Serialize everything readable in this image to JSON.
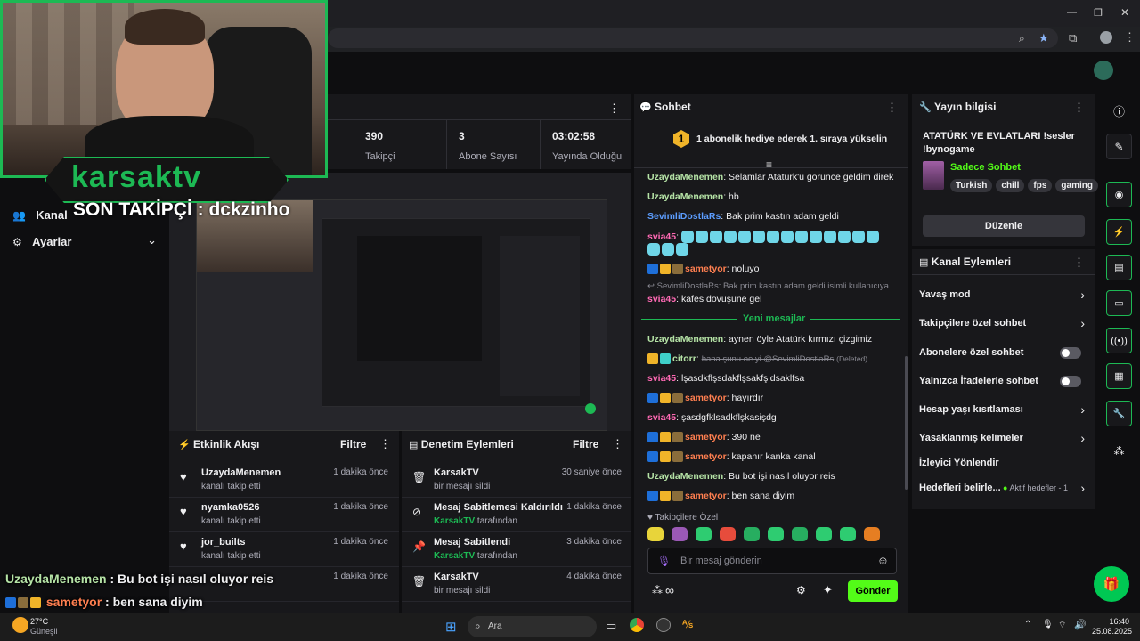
{
  "browser": {
    "controls": [
      "—",
      "❐",
      "✕"
    ]
  },
  "left_nav": {
    "items": [
      {
        "label": "Kanal"
      },
      {
        "label": "Ayarlar"
      }
    ]
  },
  "webcam": {
    "channel": "karsaktv",
    "last_follower": "SON TAKİPÇİ : dckzinho"
  },
  "stats": [
    {
      "value": "390",
      "label": "Takipçi"
    },
    {
      "value": "3",
      "label": "Abone Sayısı"
    },
    {
      "value": "03:02:58",
      "label": "Yayında Olduğu"
    }
  ],
  "activity_feed": {
    "title": "Etkinlik Akışı",
    "filter": "Filtre",
    "rows": [
      {
        "user": "UzaydaMenemen",
        "action": "kanalı takip etti",
        "time": "1 dakika önce"
      },
      {
        "user": "nyamka0526",
        "action": "kanalı takip etti",
        "time": "1 dakika önce"
      },
      {
        "user": "jor_builts",
        "action": "kanalı takip etti",
        "time": "1 dakika önce"
      },
      {
        "user": "",
        "action": "",
        "time": "1 dakika önce"
      }
    ]
  },
  "mod_actions": {
    "title": "Denetim Eylemleri",
    "filter": "Filtre",
    "rows": [
      {
        "title": "KarsakTV",
        "sub_user": "",
        "sub": "bir mesajı sildi",
        "time": "30 saniye önce"
      },
      {
        "title": "Mesaj Sabitlemesi Kaldırıldı",
        "sub_user": "KarsakTV",
        "sub": "tarafından",
        "time": "1 dakika önce"
      },
      {
        "title": "Mesaj Sabitlendi",
        "sub_user": "KarsakTV",
        "sub": "tarafından",
        "time": "3 dakika önce"
      },
      {
        "title": "KarsakTV",
        "sub_user": "",
        "sub": "bir mesajı sildi",
        "time": "4 dakika önce"
      }
    ]
  },
  "chat": {
    "title": "Sohbet",
    "pinned": "1 abonelik hediye ederek 1. sıraya yükselin",
    "pinned_badge": "1",
    "messages": [
      {
        "user": "UzaydaMenemen",
        "text": "Selamlar Atatürk'ü görünce geldim direk",
        "color": "green"
      },
      {
        "user": "UzaydaMenemen",
        "text": "hb",
        "color": "green"
      },
      {
        "user": "SevimliDostlaRs",
        "text": "Bak prim kastın adam geldi",
        "color": "blue"
      },
      {
        "user": "svia45",
        "text": "",
        "color": "pink"
      },
      {
        "user": "sametyor",
        "text": "noluyo",
        "color": "orange"
      },
      {
        "user": "",
        "text": "SevimliDostlaRs: Bak prim kastın adam geldi isimli kullanıcıya...",
        "color": "muted"
      },
      {
        "user": "svia45",
        "text": "kafes dövüşüne gel",
        "color": "pink"
      }
    ],
    "new_messages": "Yeni mesajlar",
    "messages2": [
      {
        "user": "UzaydaMenemen",
        "text": "aynen öyle Atatürk kırmızı çizgimiz",
        "color": "green"
      },
      {
        "user": "citorr",
        "text": "bana şunu oe yi @SevimliDostlaRs",
        "deleted": "(Deleted)",
        "color": "green"
      },
      {
        "user": "svia45",
        "text": "lşasdkflşsdakflşsakfşldsaklfsa",
        "color": "pink"
      },
      {
        "user": "sametyor",
        "text": "hayırdır",
        "color": "orange"
      },
      {
        "user": "svia45",
        "text": "şasdgfklsadkflşkasişdg",
        "color": "pink"
      },
      {
        "user": "sametyor",
        "text": "390 ne",
        "color": "orange"
      },
      {
        "user": "sametyor",
        "text": "kapanır kanka kanal",
        "color": "orange"
      },
      {
        "user": "UzaydaMenemen",
        "text": "Bu bot işi nasıl oluyor reis",
        "color": "green"
      },
      {
        "user": "sametyor",
        "text": "ben sana diyim",
        "color": "orange"
      }
    ],
    "followers_only": "Takipçilere Özel",
    "input_placeholder": "Bir mesaj gönderin",
    "send_button": "Gönder",
    "infinity": "∞"
  },
  "stream_info": {
    "title": "Yayın bilgisi",
    "stream_title": "ATATÜRK VE EVLATLARI !sesler !bynogame",
    "category": "Sadece Sohbet",
    "tags": [
      "Turkish",
      "chill",
      "fps",
      "gaming"
    ],
    "edit_button": "Düzenle"
  },
  "channel_actions": {
    "title": "Kanal Eylemleri",
    "items": [
      {
        "label": "Yavaş mod",
        "kind": "arrow"
      },
      {
        "label": "Takipçilere özel sohbet",
        "kind": "arrow"
      },
      {
        "label": "Abonelere özel sohbet",
        "kind": "toggle"
      },
      {
        "label": "Yalnızca İfadelerle sohbet",
        "kind": "toggle"
      },
      {
        "label": "Hesap yaşı kısıtlaması",
        "kind": "arrow"
      },
      {
        "label": "Yasaklanmış kelimeler",
        "kind": "arrow"
      },
      {
        "label": "İzleyici Yönlendir",
        "kind": "none"
      },
      {
        "label": "Hedefleri belirle...",
        "kind": "arrow"
      }
    ],
    "goals_status": "Aktif hedefler - 1"
  },
  "overlay_chat": [
    {
      "user": "UzaydaMenemen",
      "text": "Bu bot işi nasıl oluyor reis"
    },
    {
      "user": "sametyor",
      "text": "ben sana diyim"
    }
  ],
  "taskbar": {
    "weather_temp": "27°C",
    "weather_desc": "Güneşli",
    "search": "Ara",
    "time": "16:40",
    "date": "25.08.2025"
  },
  "colors": {
    "accent": "#1db954",
    "kick_green": "#53fc18"
  }
}
